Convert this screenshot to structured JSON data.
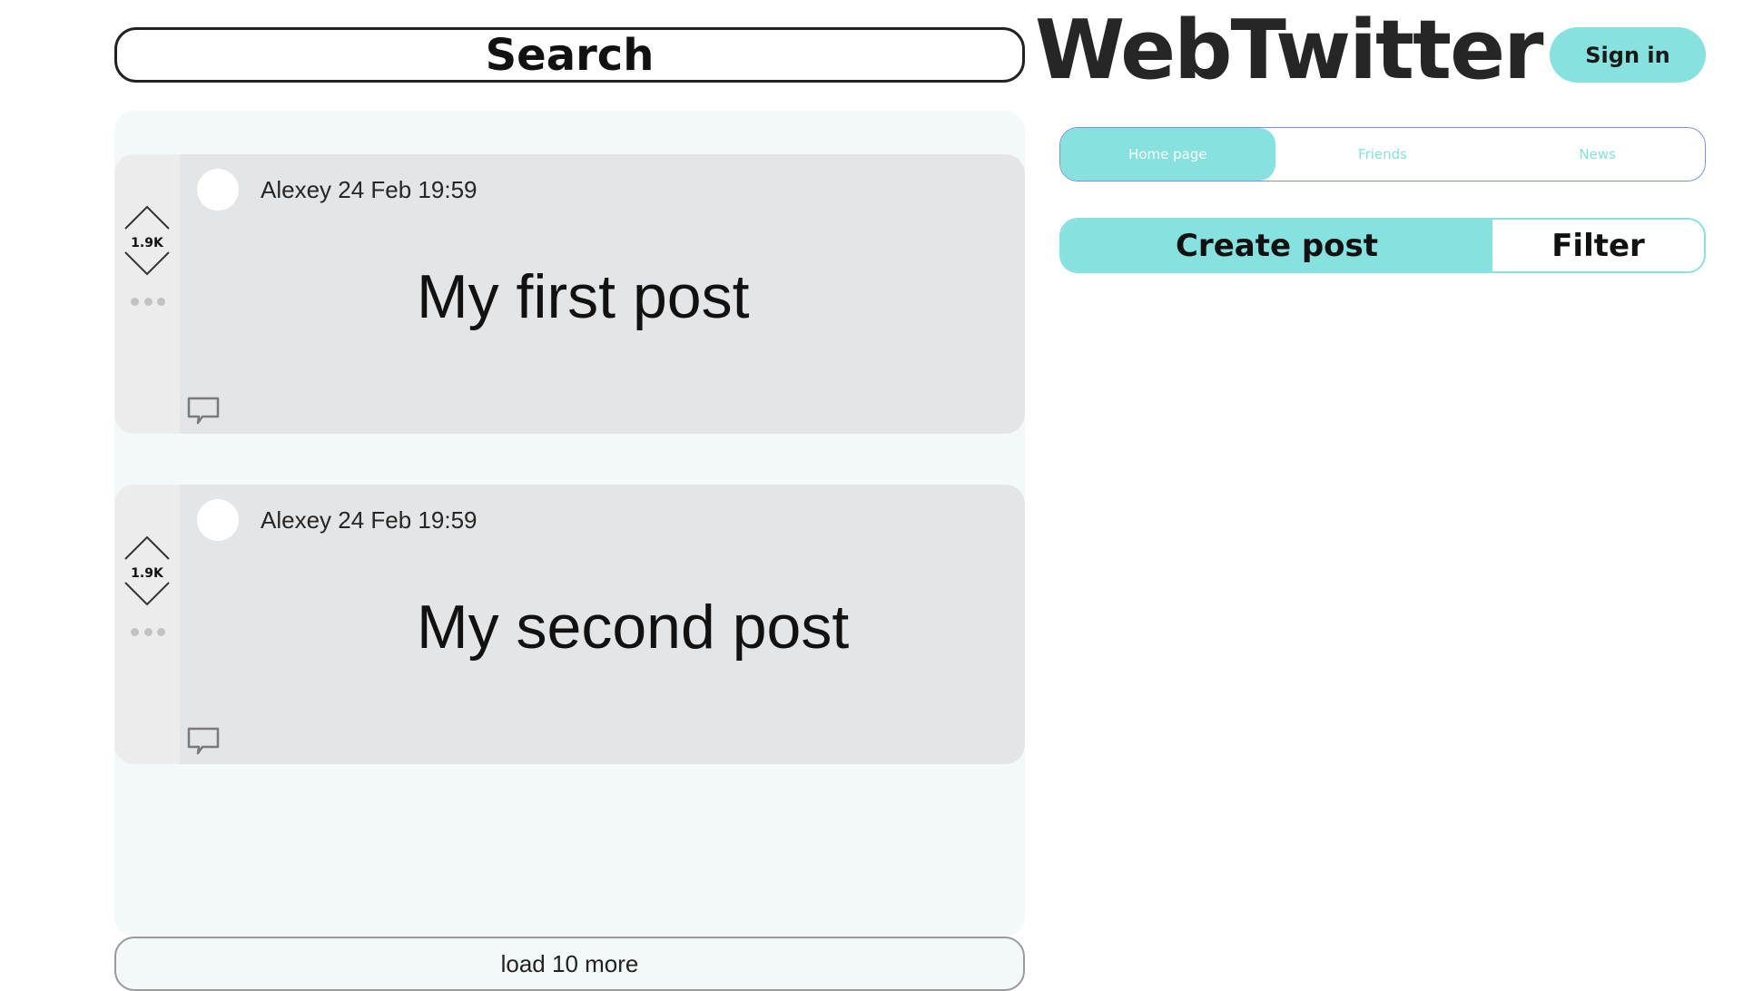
{
  "header": {
    "search_label": "Search",
    "logo": "WebTwitter",
    "sign_in_label": "Sign in"
  },
  "nav": {
    "tabs": [
      {
        "label": "Home page",
        "active": true
      },
      {
        "label": "Friends",
        "active": false
      },
      {
        "label": "News",
        "active": false
      }
    ]
  },
  "actions": {
    "create_post_label": "Create post",
    "filter_label": "Filter"
  },
  "posts": [
    {
      "meta": "Alexey 24 Feb 19:59",
      "body": "My first post",
      "votes": "1.9K"
    },
    {
      "meta": "Alexey 24 Feb 19:59",
      "body": "My second post",
      "votes": "1.9K"
    }
  ],
  "feed": {
    "load_more_label": "load 10 more"
  },
  "colors": {
    "accent": "#86e1df",
    "feed_background": "#f3f8f8",
    "post_background": "#e4e5e7",
    "nav_border": "#7a93d8"
  },
  "icons": {
    "upvote": "chevron-up-icon",
    "downvote": "chevron-down-icon",
    "more": "more-dots-icon",
    "comment": "comment-icon"
  }
}
